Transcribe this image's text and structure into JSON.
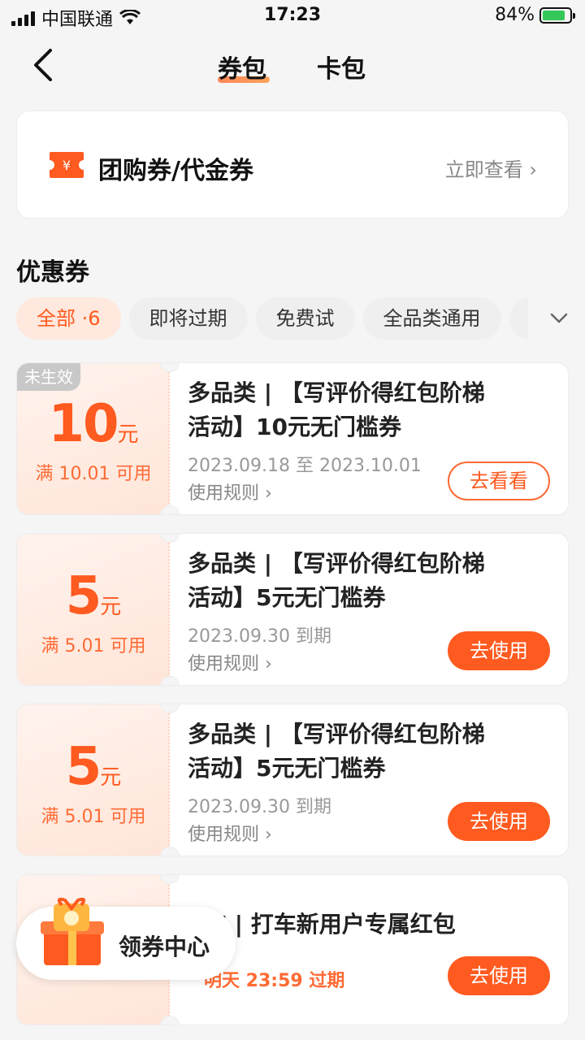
{
  "status_bar": {
    "carrier": "中国联通",
    "time": "17:23",
    "battery_percent": "84%",
    "battery_level": 0.84
  },
  "nav": {
    "tab_coupon": "券包",
    "tab_card": "卡包"
  },
  "group_card": {
    "icon": "ticket-icon",
    "icon_glyph": "¥",
    "title": "团购券/代金券",
    "link": "立即查看 ›"
  },
  "section_title": "优惠券",
  "filters": [
    {
      "label": "全部 ·6",
      "active": true
    },
    {
      "label": "即将过期",
      "active": false
    },
    {
      "label": "免费试",
      "active": false
    },
    {
      "label": "全品类通用",
      "active": false
    }
  ],
  "coupons": [
    {
      "badge": "未生效",
      "amount": "10",
      "unit": "元",
      "threshold": "满 10.01 可用",
      "title_line1": "多品类 | 【写评价得红包阶梯",
      "title_line2": "活动】10元无门槛券",
      "date": "2023.09.18 至 2023.10.01",
      "rule": "使用规则 ›",
      "button": "去看看"
    },
    {
      "amount": "5",
      "unit": "元",
      "threshold": "满 5.01 可用",
      "title_line1": "多品类 | 【写评价得红包阶梯",
      "title_line2": "活动】5元无门槛券",
      "date": "2023.09.30 到期",
      "rule": "使用规则 ›",
      "button": "去使用"
    },
    {
      "amount": "5",
      "unit": "元",
      "threshold": "满 5.01 可用",
      "title_line1": "多品类 | 【写评价得红包阶梯",
      "title_line2": "活动】5元无门槛券",
      "date": "2023.09.30 到期",
      "rule": "使用规则 ›",
      "button": "去使用"
    },
    {
      "title_line1": "车 | 打车新用户专属红包",
      "expire": "明天 23:59 过期",
      "button": "去使用"
    }
  ],
  "float_center": {
    "label": "领券中心",
    "icon": "gift-box-icon"
  },
  "colors": {
    "accent": "#ff5a1f",
    "chip_active_bg": "#ffe8dd",
    "coupon_left_bg": "#ffe5d8"
  }
}
